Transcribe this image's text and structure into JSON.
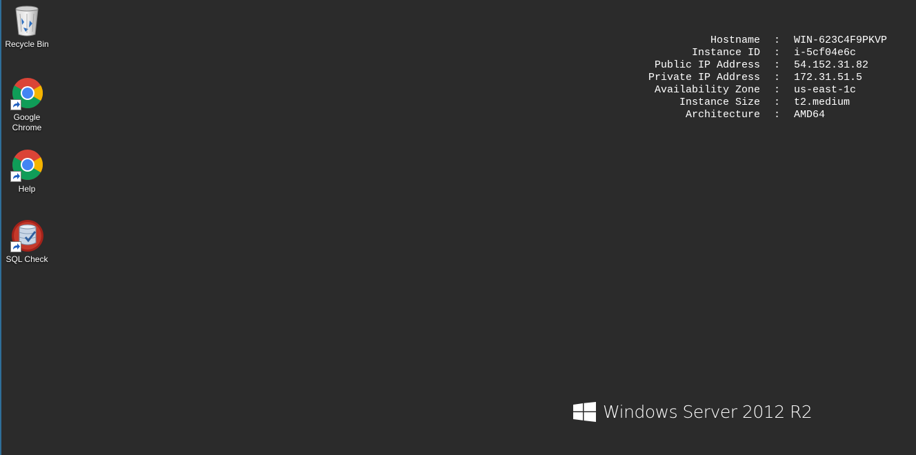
{
  "desktop": {
    "background_color": "#2b2b2b",
    "icons": [
      {
        "label": "Recycle Bin",
        "icon": "recycle-bin-icon"
      },
      {
        "label": "Google\nChrome",
        "icon": "chrome-icon"
      },
      {
        "label": "Help",
        "icon": "chrome-icon"
      },
      {
        "label": "SQL Check",
        "icon": "sql-check-icon"
      }
    ]
  },
  "instance_info": {
    "separator": ":",
    "rows": [
      {
        "key": "Hostname",
        "value": "WIN-623C4F9PKVP"
      },
      {
        "key": "Instance ID",
        "value": "i-5cf04e6c"
      },
      {
        "key": "Public IP Address",
        "value": "54.152.31.82"
      },
      {
        "key": "Private IP Address",
        "value": "172.31.51.5"
      },
      {
        "key": "Availability Zone",
        "value": "us-east-1c"
      },
      {
        "key": "Instance Size",
        "value": "t2.medium"
      },
      {
        "key": "Architecture",
        "value": "AMD64"
      }
    ]
  },
  "branding": {
    "text": "Windows Server 2012 R2",
    "logo": "windows-logo-icon"
  }
}
